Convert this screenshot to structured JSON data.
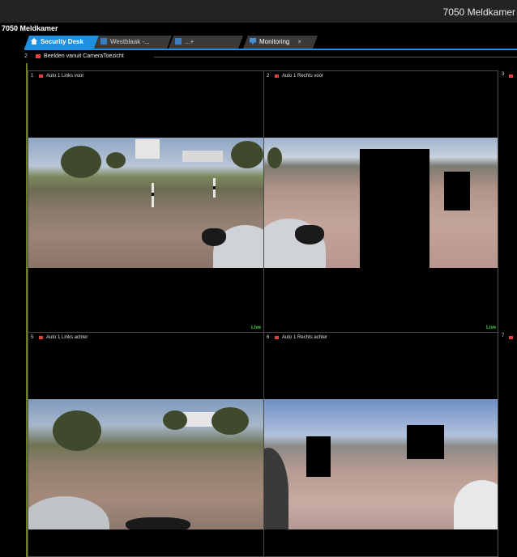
{
  "window": {
    "title": "7050 Meldkamer"
  },
  "app": {
    "label": "7050 Meldkamer"
  },
  "tabs": [
    {
      "label": "Security Desk",
      "active": true
    },
    {
      "label": "Westblaak -...",
      "active": false
    },
    {
      "label": "...+",
      "active": false
    },
    {
      "label": "Monitoring",
      "active": false,
      "close": "×"
    }
  ],
  "group": {
    "number": "2",
    "title": "Beelden vanuit CameraToezicht"
  },
  "tiles": [
    {
      "number": "1",
      "name": "Auto 1 Links voor",
      "status": "Live"
    },
    {
      "number": "2",
      "name": "Auto 1 Rechts voor",
      "status": "Live"
    },
    {
      "number": "5",
      "name": "Auto 1 Links achter",
      "status": ""
    },
    {
      "number": "6",
      "name": "Auto 1 Rechts achter",
      "status": ""
    }
  ],
  "partial_tiles": [
    {
      "number": "3"
    },
    {
      "number": "7"
    }
  ],
  "colors": {
    "accent": "#1f8fe0",
    "live": "#39d139",
    "record": "#e04040"
  }
}
